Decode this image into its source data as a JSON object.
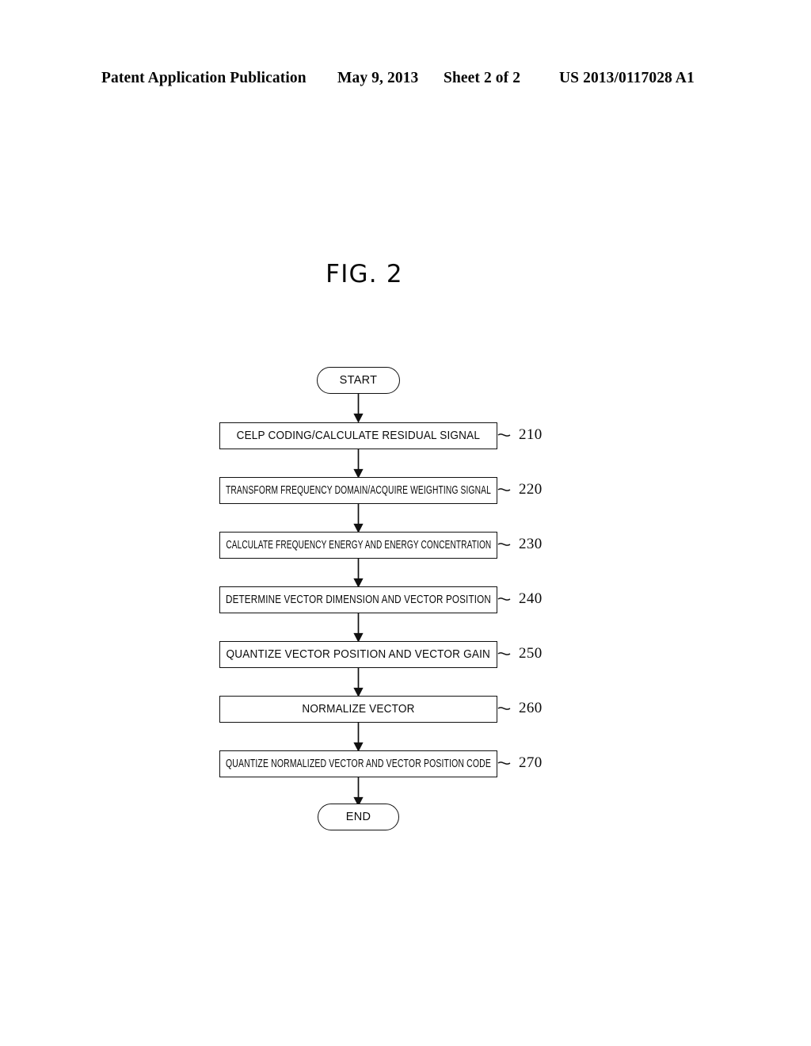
{
  "header": {
    "publication": "Patent Application Publication",
    "date": "May 9, 2013",
    "sheet": "Sheet 2 of 2",
    "patent_number": "US 2013/0117028 A1"
  },
  "figure": {
    "title": "FIG. 2"
  },
  "flowchart": {
    "start_label": "START",
    "end_label": "END",
    "steps": [
      {
        "text": "CELP CODING/CALCULATE RESIDUAL SIGNAL",
        "ref": "210"
      },
      {
        "text": "TRANSFORM FREQUENCY DOMAIN/ACQUIRE WEIGHTING SIGNAL",
        "ref": "220"
      },
      {
        "text": "CALCULATE FREQUENCY ENERGY AND ENERGY CONCENTRATION",
        "ref": "230"
      },
      {
        "text": "DETERMINE VECTOR DIMENSION AND VECTOR POSITION",
        "ref": "240"
      },
      {
        "text": "QUANTIZE VECTOR POSITION AND VECTOR GAIN",
        "ref": "250"
      },
      {
        "text": "NORMALIZE VECTOR",
        "ref": "260"
      },
      {
        "text": "QUANTIZE NORMALIZED VECTOR AND VECTOR POSITION CODE",
        "ref": "270"
      }
    ]
  }
}
